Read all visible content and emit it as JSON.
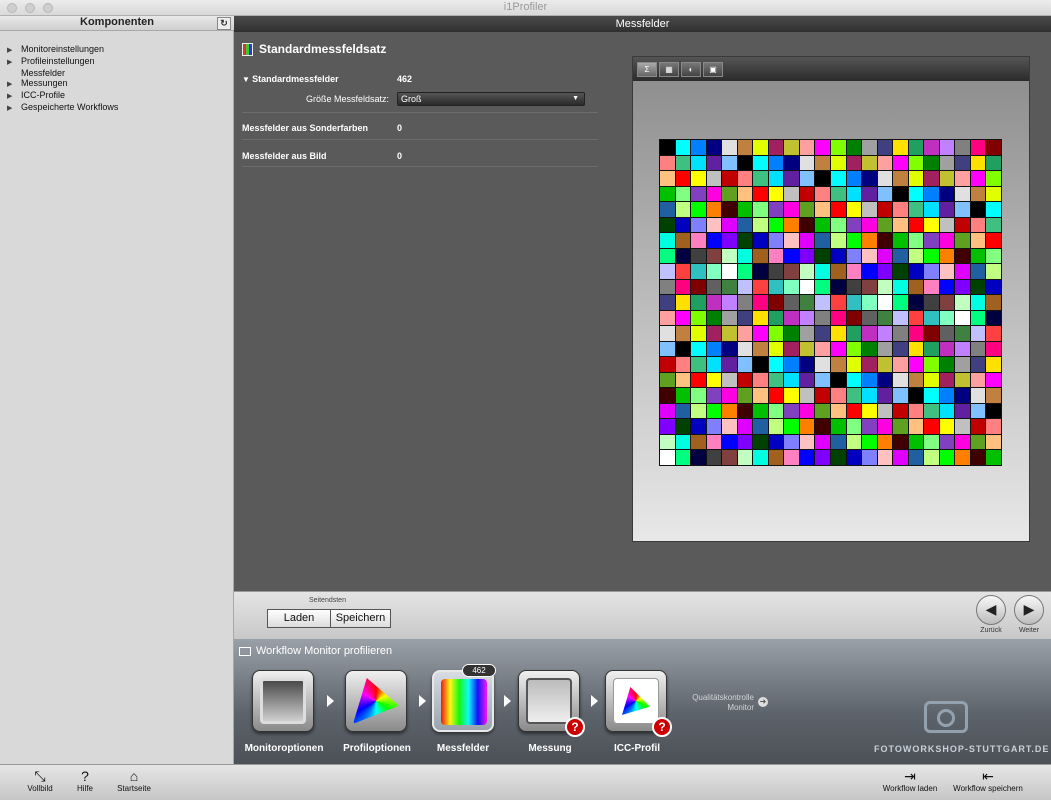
{
  "window": {
    "title": "i1Profiler"
  },
  "sidebar": {
    "title": "Komponenten",
    "items": [
      {
        "label": "Monitoreinstellungen",
        "arrow": true
      },
      {
        "label": "Profileinstellungen",
        "arrow": true
      },
      {
        "label": "Messfelder",
        "arrow": false
      },
      {
        "label": "Messungen",
        "arrow": true
      },
      {
        "label": "ICC-Profile",
        "arrow": true
      },
      {
        "label": "Gespeicherte Workflows",
        "arrow": true
      }
    ]
  },
  "main": {
    "header": "Messfelder",
    "section_title": "Standardmessfeldsatz",
    "standard_label": "Standardmessfelder",
    "standard_count": "462",
    "size_label": "Größe Messfeldsatz:",
    "size_value": "Groß",
    "spot_label": "Messfelder aus Sonderfarben",
    "spot_count": "0",
    "image_label": "Messfelder aus Bild",
    "image_count": "0"
  },
  "preview": {
    "tools": [
      "Σ",
      "▦",
      "◐",
      "▣"
    ],
    "colors": [
      "#000000",
      "#ff0000",
      "#00ff00",
      "#0000ff",
      "#ffffff",
      "#808080",
      "#ff00ff",
      "#00ffff",
      "#ffff00",
      "#ff8000",
      "#8000ff",
      "#00ff80",
      "#ff0080",
      "#80ff00",
      "#0080ff",
      "#c0c0c0",
      "#400000",
      "#004000",
      "#000040",
      "#800000",
      "#008000",
      "#000080",
      "#c00000",
      "#00c000",
      "#0000c0",
      "#404040",
      "#606060",
      "#a0a0a0",
      "#e0e0e0",
      "#ff8080",
      "#80ff80",
      "#8080ff",
      "#804040",
      "#408040",
      "#404080",
      "#c08040",
      "#40c080",
      "#8040c0",
      "#ffc0c0",
      "#c0ffc0",
      "#c0c0ff",
      "#ffe000",
      "#e0ff00",
      "#00e0ff",
      "#ff00e0",
      "#e000ff",
      "#00ffe0",
      "#ff4040",
      "#20a060",
      "#a02060",
      "#6020a0",
      "#60a020",
      "#2060a0",
      "#a06020",
      "#30c0c0",
      "#c030c0",
      "#c0c030",
      "#80c0ff",
      "#ffc080",
      "#c0ff80",
      "#ff80c0",
      "#80ffc0",
      "#c080ff",
      "#ffa0a0"
    ]
  },
  "pager": {
    "group_label": "Seitendsten",
    "load": "Laden",
    "save": "Speichern",
    "back": "Zurück",
    "next": "Weiter"
  },
  "workflow": {
    "title": "Workflow Monitor profilieren",
    "badge": "462",
    "steps": [
      {
        "label": "Monitoroptionen",
        "warn": false
      },
      {
        "label": "Profiloptionen",
        "warn": false
      },
      {
        "label": "Messfelder",
        "warn": false
      },
      {
        "label": "Messung",
        "warn": true
      },
      {
        "label": "ICC-Profil",
        "warn": true
      }
    ],
    "quality_line1": "Qualitätskontrolle",
    "quality_line2": "Monitor",
    "watermark": "FOTOWORKSHOP-STUTTGART.DE"
  },
  "bottom": {
    "left": [
      "Vollbild",
      "Hilfe",
      "Startseite"
    ],
    "right": [
      "Workflow laden",
      "Workflow speichern"
    ]
  }
}
